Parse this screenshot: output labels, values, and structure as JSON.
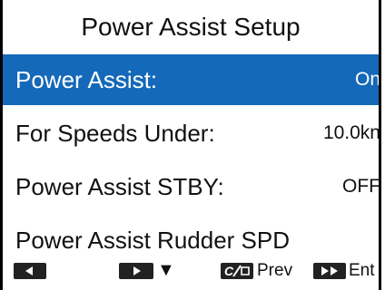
{
  "screen": {
    "title": "Power Assist Setup",
    "menu": [
      {
        "label": "Power Assist:",
        "value": "On",
        "selected": true
      },
      {
        "label": "For Speeds Under:",
        "value": "10.0kn",
        "selected": false
      },
      {
        "label": "Power Assist STBY:",
        "value": "OFF",
        "selected": false
      },
      {
        "label": "Power Assist Rudder SPD",
        "value": "",
        "selected": false
      }
    ],
    "footer": {
      "down_symbol": "▼",
      "prev_label": "Prev",
      "ent_label": "Ent"
    },
    "colors": {
      "selection": "#1469b8",
      "key": "#222222"
    }
  }
}
